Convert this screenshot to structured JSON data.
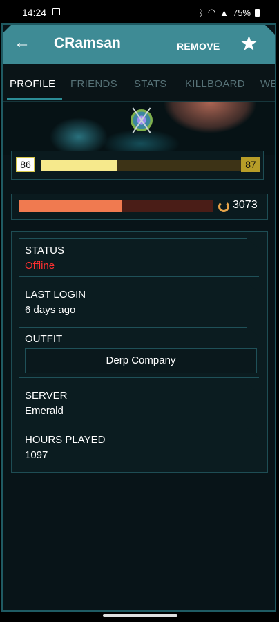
{
  "statusbar": {
    "time": "14:24",
    "battery": "75%"
  },
  "header": {
    "title": "CRamsan",
    "remove_label": "REMOVE"
  },
  "tabs": [
    "PROFILE",
    "FRIENDS",
    "STATS",
    "KILLBOARD",
    "WE"
  ],
  "rank": {
    "current": "86",
    "next": "87",
    "progress": 0.38
  },
  "certs": {
    "value": "3073",
    "progress": 0.53
  },
  "info": {
    "status": {
      "label": "STATUS",
      "value": "Offline"
    },
    "last_login": {
      "label": "LAST LOGIN",
      "value": "6 days ago"
    },
    "outfit": {
      "label": "OUTFIT",
      "value": "Derp Company"
    },
    "server": {
      "label": "SERVER",
      "value": "Emerald"
    },
    "hours_played": {
      "label": "HOURS PLAYED",
      "value": "1097"
    }
  },
  "colors": {
    "accent": "#3e8b95",
    "offline": "#ff3030",
    "rank_fill": "#f6e98c",
    "cert_fill": "#f07a50"
  }
}
